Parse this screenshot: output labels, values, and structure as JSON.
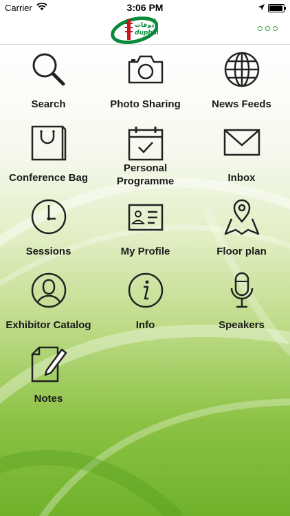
{
  "status_bar": {
    "carrier": "Carrier",
    "time": "3:06 PM"
  },
  "navbar": {
    "logo_text_arabic": "دوفات",
    "logo_text_latin": "duphat",
    "logo_registered": "®",
    "more_icon": "more-dots-icon"
  },
  "colors": {
    "accent": "#3a9a36",
    "logo_red": "#c4161c",
    "logo_green": "#0a8a3a"
  },
  "menu": {
    "items": [
      {
        "label": "Search",
        "icon": "search-icon"
      },
      {
        "label": "Photo Sharing",
        "icon": "camera-icon"
      },
      {
        "label": "News Feeds",
        "icon": "globe-icon"
      },
      {
        "label": "Conference Bag",
        "icon": "bag-icon"
      },
      {
        "label": "Personal Programme",
        "icon": "calendar-check-icon"
      },
      {
        "label": "Inbox",
        "icon": "envelope-icon"
      },
      {
        "label": "Sessions",
        "icon": "clock-icon"
      },
      {
        "label": "My Profile",
        "icon": "id-card-icon"
      },
      {
        "label": "Floor plan",
        "icon": "map-pin-icon"
      },
      {
        "label": "Exhibitor Catalog",
        "icon": "person-icon"
      },
      {
        "label": "Info",
        "icon": "info-icon"
      },
      {
        "label": "Speakers",
        "icon": "microphone-icon"
      },
      {
        "label": "Notes",
        "icon": "notes-pen-icon"
      }
    ]
  }
}
